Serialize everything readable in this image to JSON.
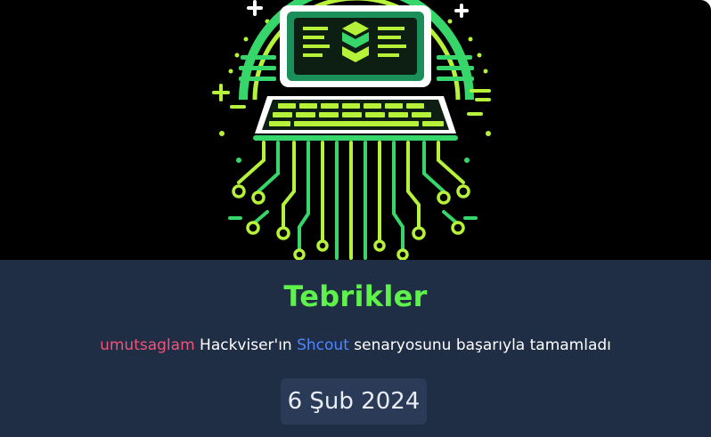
{
  "hero": {
    "icon": "laptop-circuit-illustration",
    "colors": {
      "background": "#000000",
      "lime": "#b7f23a",
      "green": "#37d66a",
      "teal": "#2bbf8a",
      "white": "#ffffff"
    }
  },
  "card": {
    "title": "Tebrikler",
    "username": "umutsaglam",
    "message_part1": " Hackviser'ın ",
    "scenario": "Shcout",
    "message_part2": " senaryosunu başarıyla tamamladı",
    "date": "6 Şub 2024",
    "colors": {
      "background": "#1f2d45",
      "title": "#5ef24a",
      "username": "#f2537a",
      "scenario": "#4f86ff",
      "badge": "#2a3a57"
    }
  }
}
